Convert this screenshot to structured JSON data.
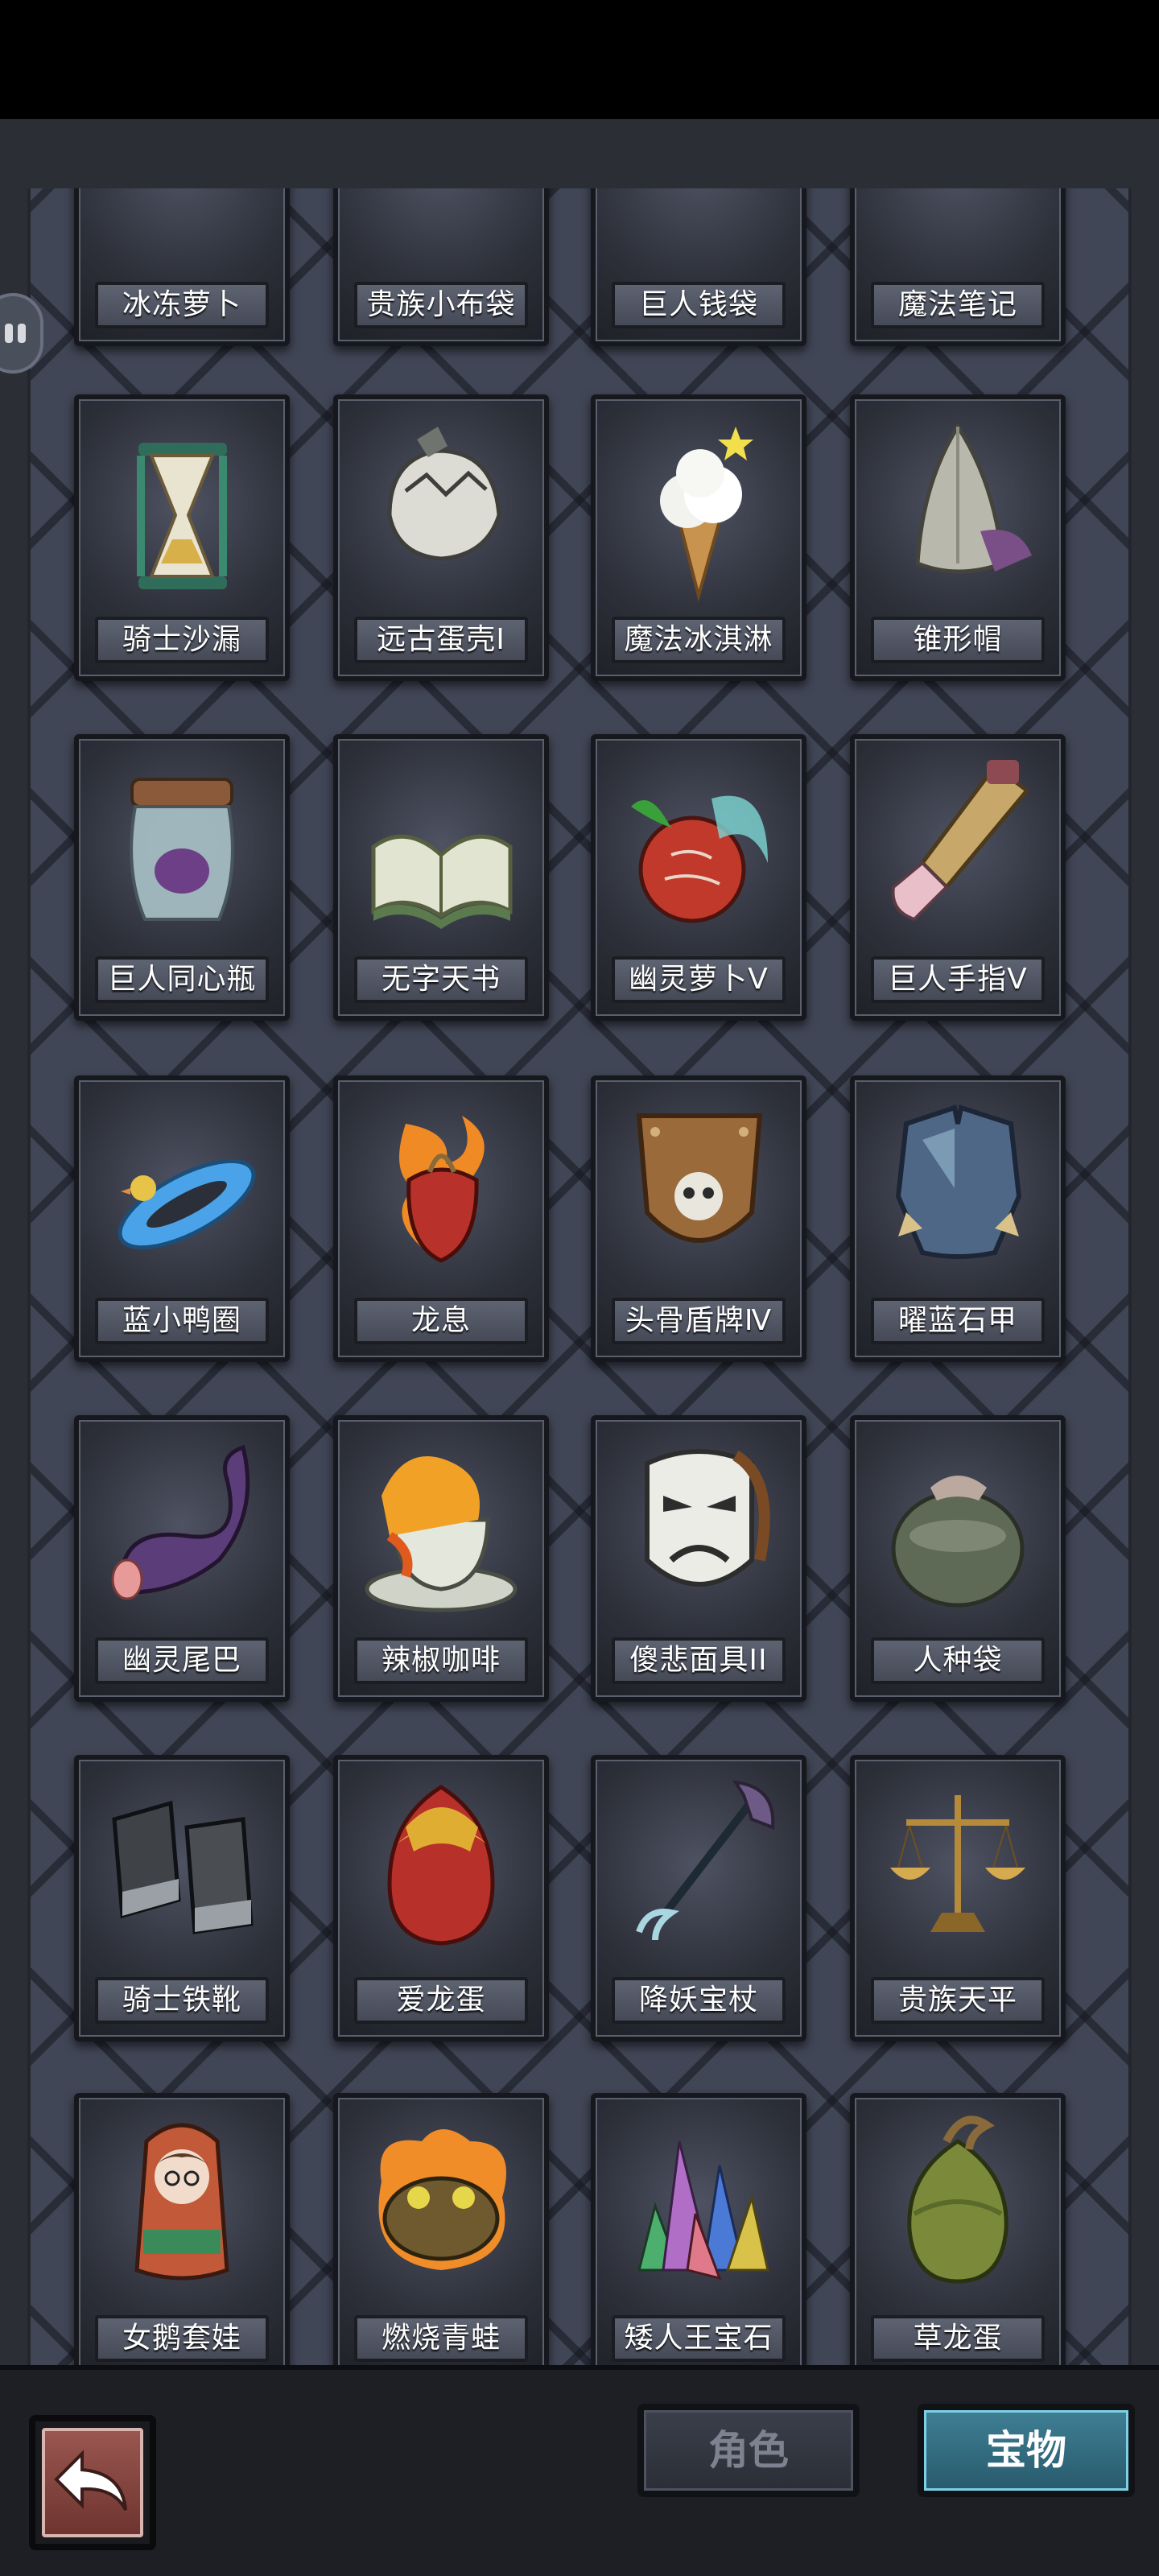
{
  "items": [
    {
      "label": "冰冻萝卜",
      "icon": "frozen-radish-icon"
    },
    {
      "label": "贵族小布袋",
      "icon": "noble-pouch-icon"
    },
    {
      "label": "巨人钱袋",
      "icon": "giant-purse-icon"
    },
    {
      "label": "魔法笔记",
      "icon": "magic-notes-icon"
    },
    {
      "label": "骑士沙漏",
      "icon": "hourglass-icon"
    },
    {
      "label": "远古蛋壳I",
      "icon": "eggshell-icon"
    },
    {
      "label": "魔法冰淇淋",
      "icon": "ice-cream-icon"
    },
    {
      "label": "锥形帽",
      "icon": "cone-helmet-icon"
    },
    {
      "label": "巨人同心瓶",
      "icon": "jar-icon"
    },
    {
      "label": "无字天书",
      "icon": "book-icon"
    },
    {
      "label": "幽灵萝卜V",
      "icon": "ghost-radish-icon"
    },
    {
      "label": "巨人手指V",
      "icon": "giant-finger-icon"
    },
    {
      "label": "蓝小鸭圈",
      "icon": "duck-ring-icon"
    },
    {
      "label": "龙息",
      "icon": "flaming-heart-icon"
    },
    {
      "label": "头骨盾牌Ⅳ",
      "icon": "skull-shield-icon"
    },
    {
      "label": "曜蓝石甲",
      "icon": "armor-icon"
    },
    {
      "label": "幽灵尾巴",
      "icon": "tail-icon"
    },
    {
      "label": "辣椒咖啡",
      "icon": "coffee-cup-icon"
    },
    {
      "label": "傻悲面具II",
      "icon": "mask-icon"
    },
    {
      "label": "人种袋",
      "icon": "seed-bag-icon"
    },
    {
      "label": "骑士铁靴",
      "icon": "iron-boots-icon"
    },
    {
      "label": "爱龙蛋",
      "icon": "dragon-egg-icon"
    },
    {
      "label": "降妖宝杖",
      "icon": "staff-icon"
    },
    {
      "label": "贵族天平",
      "icon": "scales-icon"
    },
    {
      "label": "女鹅套娃",
      "icon": "nesting-doll-icon"
    },
    {
      "label": "燃烧青蛙",
      "icon": "burning-frog-icon"
    },
    {
      "label": "矮人王宝石",
      "icon": "crystal-gems-icon"
    },
    {
      "label": "草龙蛋",
      "icon": "grass-dragon-egg-icon"
    }
  ],
  "bottom_bar": {
    "tab_role": "角色",
    "tab_treasure": "宝物",
    "active_tab": "宝物"
  }
}
